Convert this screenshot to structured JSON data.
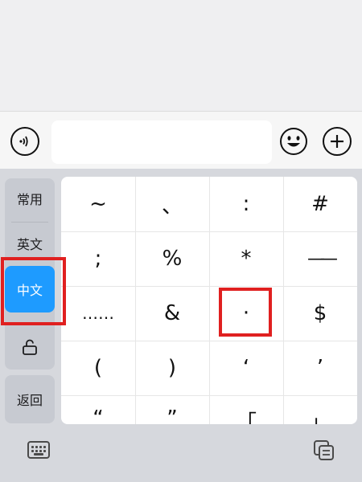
{
  "input_bar": {
    "voice_icon": "voice-wave-icon",
    "text_value": "",
    "emoji_icon": "smiley-icon",
    "plus_icon": "plus-circle-icon"
  },
  "side_panel": {
    "items": [
      {
        "label": "常用",
        "active": false
      },
      {
        "label": "英文",
        "active": false
      },
      {
        "label": "中文",
        "active": true
      },
      {
        "label": "",
        "icon": "lock-open-icon",
        "active": false
      }
    ],
    "back_label": "返回",
    "active_color": "#1e9bff"
  },
  "symbols": [
    [
      "~",
      "、",
      ":",
      "#"
    ],
    [
      ";",
      "%",
      "*",
      "——"
    ],
    [
      "……",
      "&",
      "·",
      "$"
    ],
    [
      "(",
      ")",
      "‘",
      "’"
    ],
    [
      "“",
      "”",
      "「",
      "」"
    ]
  ],
  "bottom_bar": {
    "left_icon": "keyboard-icon",
    "right_icon": "copy-icon"
  },
  "highlight_color": "#e02020"
}
